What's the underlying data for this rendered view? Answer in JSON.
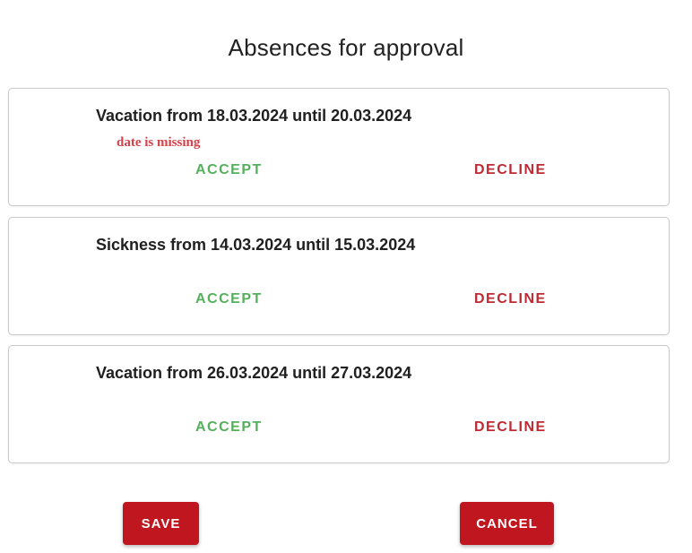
{
  "dialog": {
    "title": "Absences for approval"
  },
  "absences": [
    {
      "label": "Vacation from 18.03.2024 until 20.03.2024",
      "error": "date is missing",
      "accept_label": "ACCEPT",
      "decline_label": "DECLINE"
    },
    {
      "label": "Sickness from 14.03.2024 until 15.03.2024",
      "accept_label": "ACCEPT",
      "decline_label": "DECLINE"
    },
    {
      "label": "Vacation from 26.03.2024 until 27.03.2024",
      "accept_label": "ACCEPT",
      "decline_label": "DECLINE"
    }
  ],
  "footer": {
    "save_label": "SAVE",
    "cancel_label": "CANCEL"
  },
  "colors": {
    "accept": "#55b05d",
    "decline": "#bf2a32",
    "error": "#d6404a",
    "primary_button": "#c0161f"
  }
}
